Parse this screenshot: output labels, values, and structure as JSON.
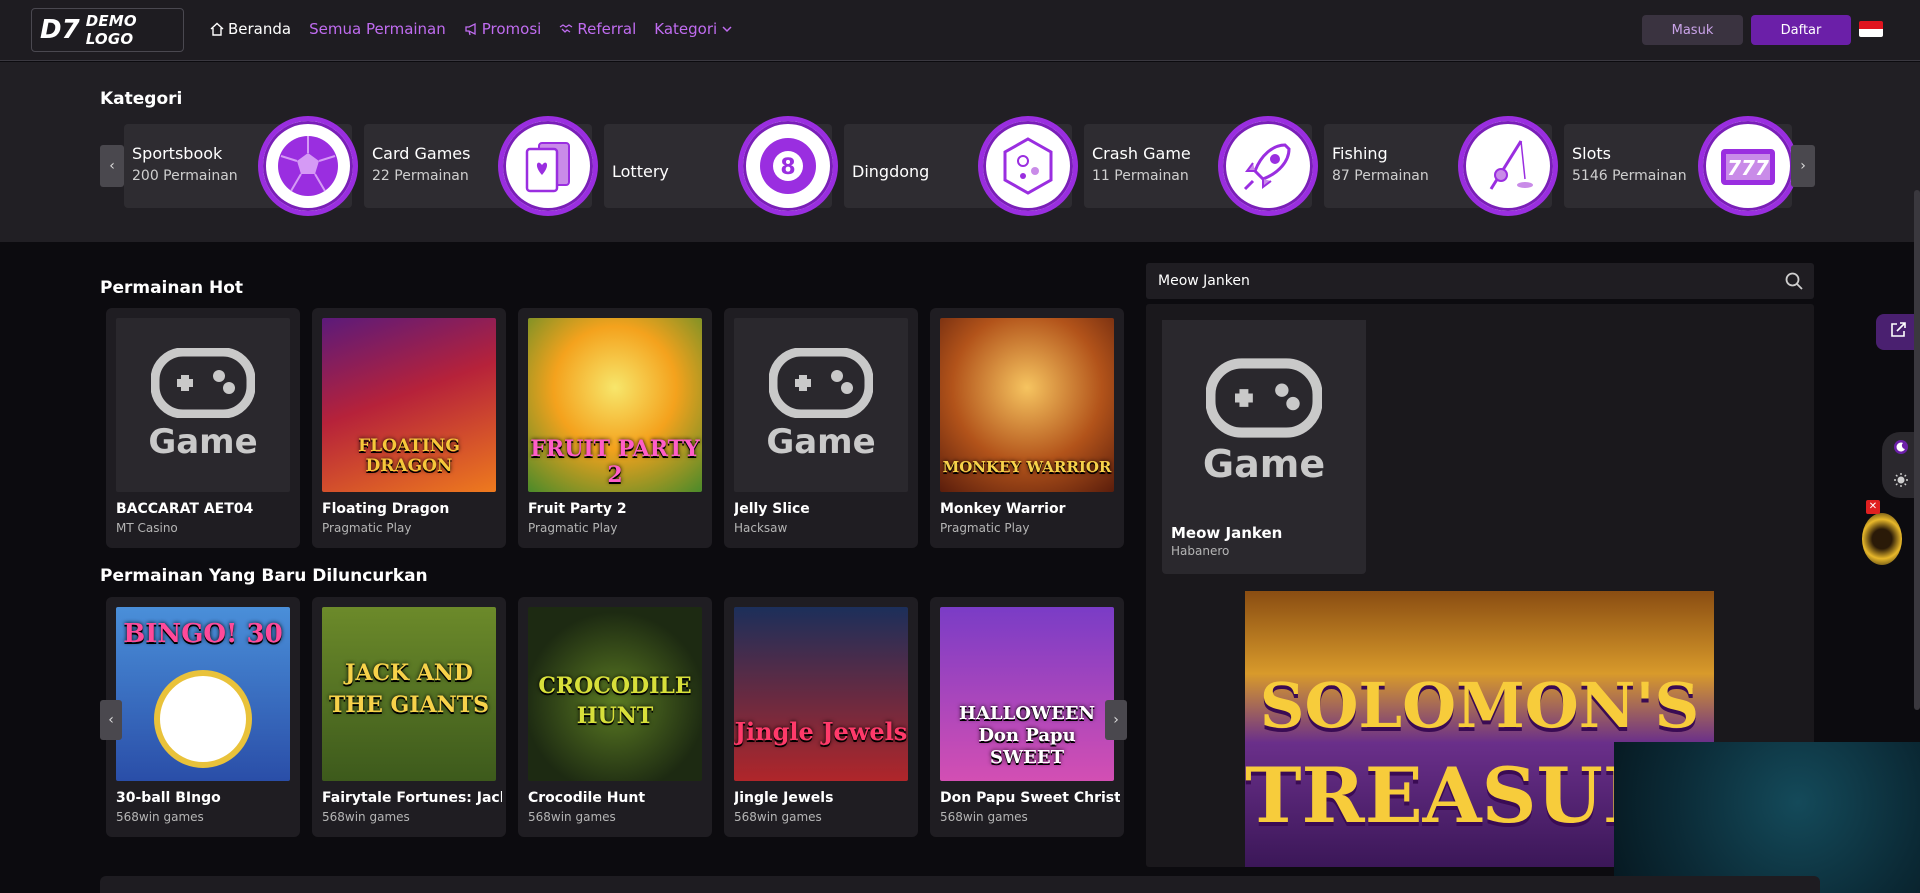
{
  "header": {
    "logo_mark": "D7",
    "logo_text": "DEMO LOGO",
    "nav": [
      {
        "label": "Beranda",
        "icon": "home-icon"
      },
      {
        "label": "Semua Permainan",
        "icon": ""
      },
      {
        "label": "Promosi",
        "icon": "megaphone-icon"
      },
      {
        "label": "Referral",
        "icon": "handshake-icon"
      },
      {
        "label": "Kategori",
        "icon": "chevron-down-icon"
      }
    ],
    "login_label": "Masuk",
    "register_label": "Daftar",
    "language_flag": "indonesia-flag"
  },
  "categories": {
    "title": "Kategori",
    "items": [
      {
        "name": "Sportsbook",
        "count": "200 Permainan",
        "icon": "soccer-ball-icon"
      },
      {
        "name": "Card Games",
        "count": "22 Permainan",
        "icon": "playing-cards-icon"
      },
      {
        "name": "Lottery",
        "count": "",
        "icon": "eight-ball-icon"
      },
      {
        "name": "Dingdong",
        "count": "",
        "icon": "lottery-drum-icon"
      },
      {
        "name": "Crash Game",
        "count": "11 Permainan",
        "icon": "rocket-icon"
      },
      {
        "name": "Fishing",
        "count": "87 Permainan",
        "icon": "fishing-rod-icon"
      },
      {
        "name": "Slots",
        "count": "5146 Permainan",
        "icon": "slot-machine-icon"
      }
    ]
  },
  "hot_games": {
    "title": "Permainan Hot",
    "items": [
      {
        "title": "BACCARAT AET04",
        "provider": "MT Casino",
        "placeholder": "Game"
      },
      {
        "title": "Floating Dragon",
        "provider": "Pragmatic Play",
        "art_text": "FLOATING DRAGON"
      },
      {
        "title": "Fruit Party 2",
        "provider": "Pragmatic Play",
        "art_text": "FRUIT PARTY 2"
      },
      {
        "title": "Jelly Slice",
        "provider": "Hacksaw",
        "placeholder": "Game"
      },
      {
        "title": "Monkey Warrior",
        "provider": "Pragmatic Play",
        "art_text": "MONKEY WARRIOR"
      }
    ]
  },
  "new_games": {
    "title": "Permainan Yang Baru Diluncurkan",
    "items": [
      {
        "title": "30-ball BIngo",
        "provider": "568win games",
        "art_text": "BINGO! 30"
      },
      {
        "title": "Fairytale Fortunes: Jack and the Giants",
        "provider": "568win games",
        "art_text": "JACK AND THE GIANTS"
      },
      {
        "title": "Crocodile Hunt",
        "provider": "568win games",
        "art_text": "CROCODILE HUNT"
      },
      {
        "title": "Jingle Jewels",
        "provider": "568win games",
        "art_text": "Jingle Jewels"
      },
      {
        "title": "Don Papu Sweet Christmas",
        "provider": "568win games",
        "art_text": "HALLOWEEN Don Papu SWEET"
      }
    ]
  },
  "search": {
    "value": "Meow Janken",
    "placeholder": "",
    "result": {
      "title": "Meow Janken",
      "provider": "Habanero",
      "placeholder": "Game"
    }
  },
  "banner": {
    "line1": "SOLOMON'S",
    "line2": "TREASURE"
  },
  "colors": {
    "accent": "#9a2ee0",
    "nav_link": "#c06cf0",
    "register_button": "#6b1fa8",
    "background": "#0c0b0f"
  }
}
